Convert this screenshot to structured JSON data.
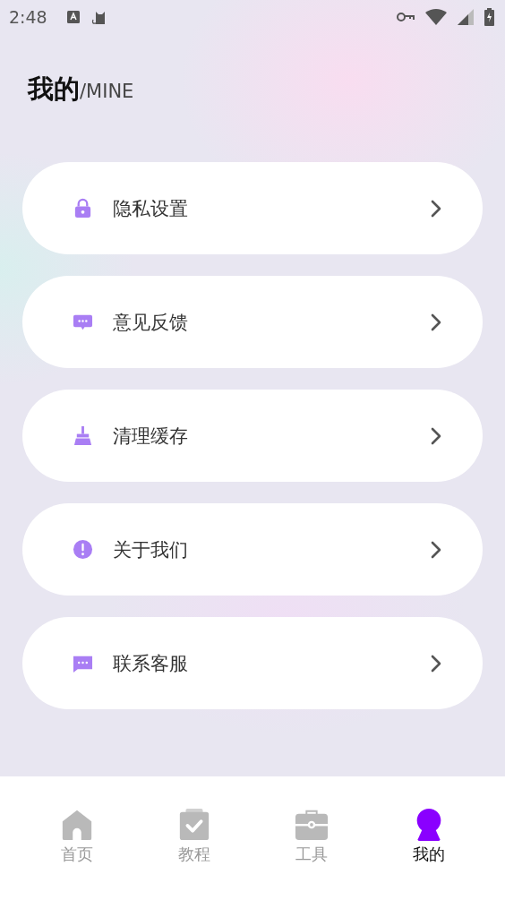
{
  "status_bar": {
    "time": "2:48"
  },
  "header": {
    "title": "我的",
    "subtitle": "/MINE"
  },
  "menu": [
    {
      "kind": "lock",
      "label": "隐私设置"
    },
    {
      "kind": "feedback",
      "label": "意见反馈"
    },
    {
      "kind": "broom",
      "label": "清理缓存"
    },
    {
      "kind": "info",
      "label": "关于我们"
    },
    {
      "kind": "chat",
      "label": "联系客服"
    }
  ],
  "tabs": [
    {
      "kind": "home",
      "label": "首页",
      "selected": false
    },
    {
      "kind": "tutorial",
      "label": "教程",
      "selected": false
    },
    {
      "kind": "tools",
      "label": "工具",
      "selected": false
    },
    {
      "kind": "mine",
      "label": "我的",
      "selected": true
    }
  ]
}
